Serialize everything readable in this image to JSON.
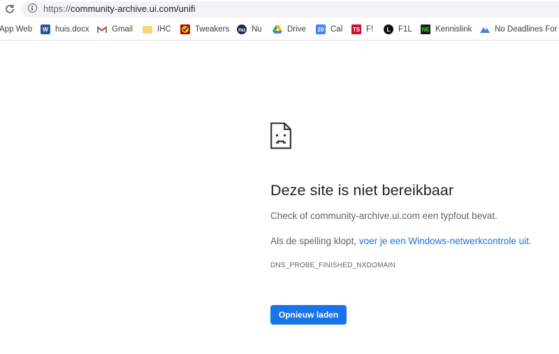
{
  "address_bar": {
    "url_prefix": "https://",
    "url_host": "community-archive.ui.com/unifi"
  },
  "bookmarks": [
    {
      "label": "App Web",
      "icon": "none"
    },
    {
      "label": "huis.docx",
      "icon": "word-icon"
    },
    {
      "label": "Gmail",
      "icon": "gmail-icon"
    },
    {
      "label": "IHC",
      "icon": "folder-icon"
    },
    {
      "label": "Tweakers",
      "icon": "tweakers-icon"
    },
    {
      "label": "Nu",
      "icon": "nu-icon"
    },
    {
      "label": "Drive",
      "icon": "drive-icon"
    },
    {
      "label": "Cal",
      "icon": "calendar-icon",
      "badge": "20"
    },
    {
      "label": "F!",
      "icon": "ts-icon",
      "badge": "TS"
    },
    {
      "label": "F1L",
      "icon": "f1l-icon",
      "badge": "L"
    },
    {
      "label": "Kennislink",
      "icon": "kennislink-icon",
      "badge": "NE"
    },
    {
      "label": "No Deadlines For Y",
      "icon": "nodeadlines-icon"
    }
  ],
  "error_page": {
    "title": "Deze site is niet bereikbaar",
    "line1": "Check of community-archive.ui.com een typfout bevat.",
    "line2_prefix": "Als de spelling klopt, ",
    "line2_link": "voer je een Windows-netwerkcontrole uit",
    "line2_suffix": ".",
    "error_code": "DNS_PROBE_FINISHED_NXDOMAIN",
    "reload_button": "Opnieuw laden"
  },
  "colors": {
    "accent": "#1a73e8",
    "text_primary": "#202124",
    "text_secondary": "#5f6368"
  }
}
